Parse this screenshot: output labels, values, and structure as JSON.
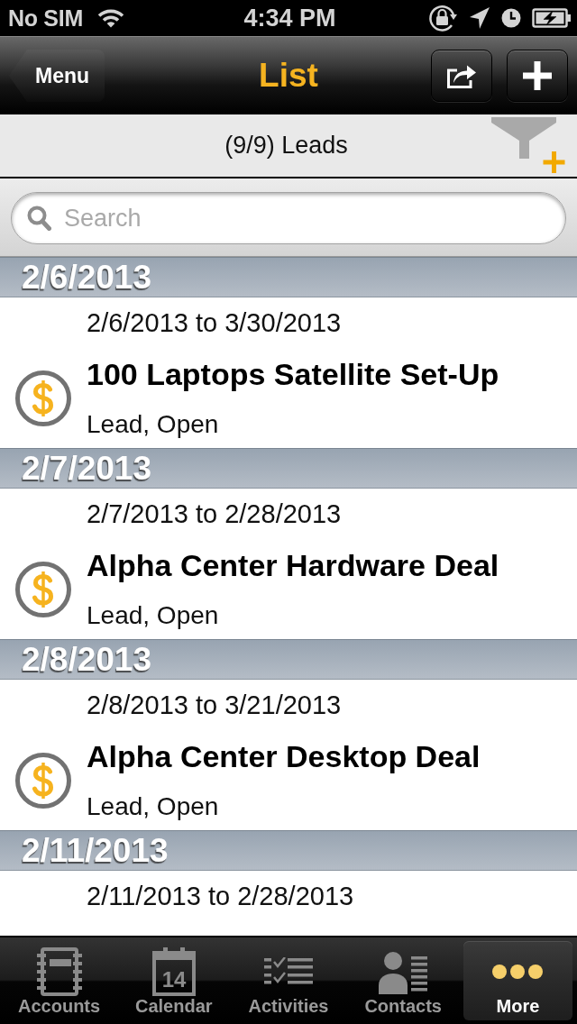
{
  "status_bar": {
    "carrier": "No SIM",
    "time": "4:34 PM"
  },
  "nav_bar": {
    "back_button": "Menu",
    "title": "List"
  },
  "filter_bar": {
    "label": "(9/9) Leads"
  },
  "search": {
    "placeholder": "Search"
  },
  "sections": [
    {
      "date": "2/6/2013",
      "items": [
        {
          "date_range": "2/6/2013 to 3/30/2013",
          "title": "100 Laptops Satellite Set-Up",
          "status": "Lead, Open"
        }
      ]
    },
    {
      "date": "2/7/2013",
      "items": [
        {
          "date_range": "2/7/2013 to 2/28/2013",
          "title": "Alpha Center Hardware Deal",
          "status": "Lead, Open"
        }
      ]
    },
    {
      "date": "2/8/2013",
      "items": [
        {
          "date_range": "2/8/2013 to 3/21/2013",
          "title": "Alpha Center Desktop Deal",
          "status": "Lead, Open"
        }
      ]
    },
    {
      "date": "2/11/2013",
      "items": [
        {
          "date_range": "2/11/2013 to 2/28/2013"
        }
      ]
    }
  ],
  "tabs": [
    {
      "label": "Accounts",
      "selected": false
    },
    {
      "label": "Calendar",
      "icon_number": "14",
      "selected": false
    },
    {
      "label": "Activities",
      "selected": false
    },
    {
      "label": "Contacts",
      "selected": false
    },
    {
      "label": "More",
      "selected": true
    }
  ]
}
